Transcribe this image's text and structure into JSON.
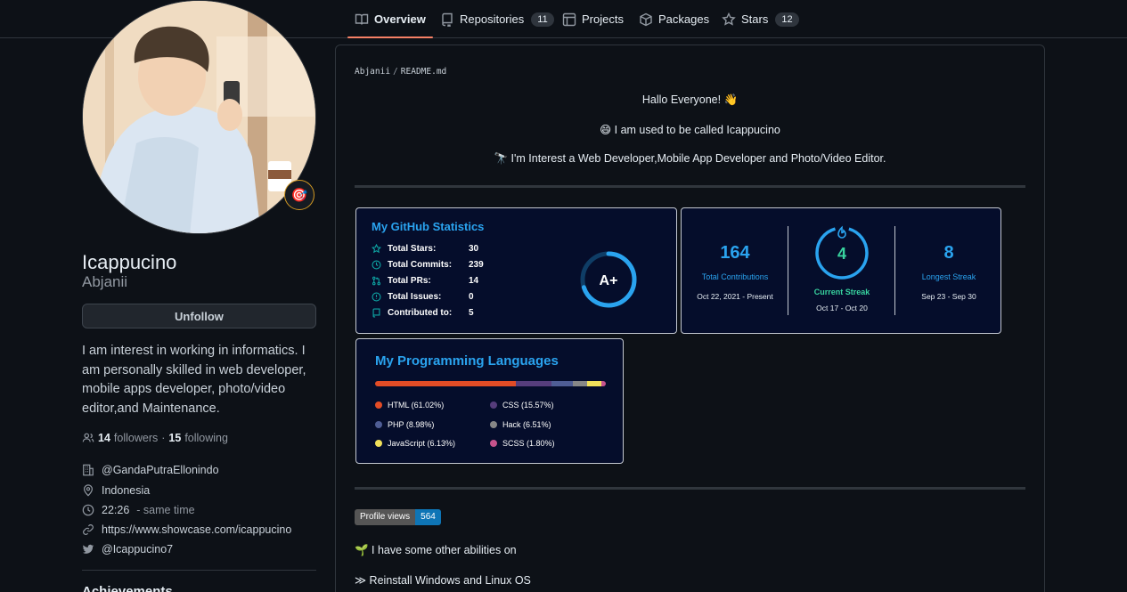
{
  "nav": {
    "tabs": [
      {
        "label": "Overview",
        "icon": "book-icon"
      },
      {
        "label": "Repositories",
        "count": "11",
        "icon": "repo-icon"
      },
      {
        "label": "Projects",
        "icon": "project-icon"
      },
      {
        "label": "Packages",
        "icon": "package-icon"
      },
      {
        "label": "Stars",
        "count": "12",
        "icon": "star-icon"
      }
    ]
  },
  "profile": {
    "name": "Icappucino",
    "username": "Abjanii",
    "status_emoji": "🎯",
    "unfollow_label": "Unfollow",
    "bio": "I am interest in working in informatics. I am personally skilled in web developer, mobile apps developer, photo/video editor,and Maintenance.",
    "followers_count": "14",
    "followers_label": "followers",
    "following_count": "15",
    "following_label": "following",
    "organization": "@GandaPutraEllonindo",
    "location": "Indonesia",
    "local_time": "22:26",
    "time_note": "- same time",
    "website": "https://www.showcase.com/icappucino",
    "twitter": "@Icappucino7",
    "achievements_heading": "Achievements"
  },
  "readme": {
    "owner": "Abjanii",
    "file": "README.md",
    "greeting": "Hallo Everyone! 👋",
    "line2": "😄 I am used to be called Icappucino",
    "line3": "🔭 I'm Interest a Web Developer,Mobile App Developer and Photo/Video Editor.",
    "profile_views_label": "Profile views",
    "profile_views_count": "564",
    "abilities_intro": "🌱 I have some other abilities on",
    "ability_1": "≫ Reinstall Windows and Linux OS"
  },
  "stats_card": {
    "title": "My GitHub Statistics",
    "rows": [
      {
        "label": "Total Stars:",
        "value": "30"
      },
      {
        "label": "Total Commits:",
        "value": "239"
      },
      {
        "label": "Total PRs:",
        "value": "14"
      },
      {
        "label": "Total Issues:",
        "value": "0"
      },
      {
        "label": "Contributed to:",
        "value": "5"
      }
    ],
    "grade": "A+",
    "grade_fill_fraction": 0.7
  },
  "streak_card": {
    "total_contributions": "164",
    "total_label": "Total Contributions",
    "total_range": "Oct 22, 2021 - Present",
    "current_streak": "4",
    "current_label": "Current Streak",
    "current_range": "Oct 17 - Oct 20",
    "longest_streak": "8",
    "longest_label": "Longest Streak",
    "longest_range": "Sep 23 - Sep 30",
    "colors": {
      "accent": "#2aa3ef",
      "current": "#38d39f"
    }
  },
  "languages_card": {
    "title": "My Programming Languages",
    "languages": [
      {
        "name": "HTML (61.02%)",
        "percent": 61.02,
        "color": "#e34c26"
      },
      {
        "name": "CSS (15.57%)",
        "percent": 15.57,
        "color": "#563d7c"
      },
      {
        "name": "PHP (8.98%)",
        "percent": 8.98,
        "color": "#4f5d95"
      },
      {
        "name": "Hack (6.51%)",
        "percent": 6.51,
        "color": "#878787"
      },
      {
        "name": "JavaScript (6.13%)",
        "percent": 6.13,
        "color": "#f1e05a"
      },
      {
        "name": "SCSS (1.80%)",
        "percent": 1.8,
        "color": "#c6538c"
      }
    ]
  }
}
